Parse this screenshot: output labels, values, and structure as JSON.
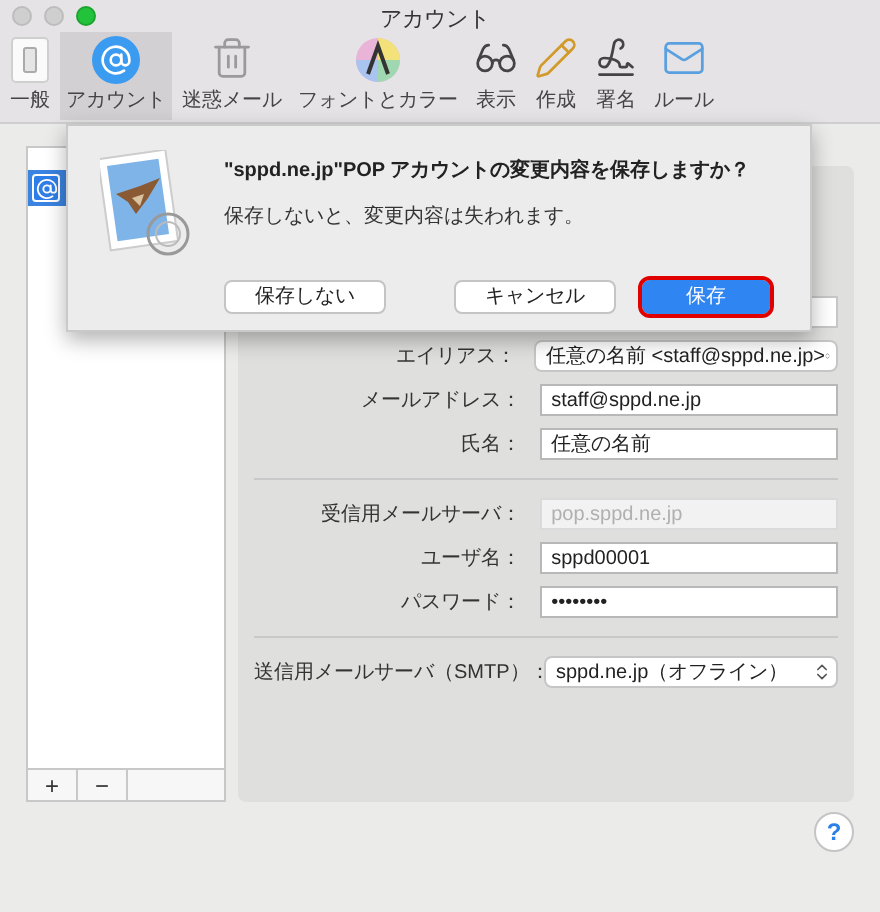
{
  "window": {
    "title": "アカウント"
  },
  "toolbar": {
    "items": [
      {
        "label": "一般",
        "selected": false
      },
      {
        "label": "アカウント",
        "selected": true
      },
      {
        "label": "迷惑メール",
        "selected": false
      },
      {
        "label": "フォントとカラー",
        "selected": false
      },
      {
        "label": "表示",
        "selected": false
      },
      {
        "label": "作成",
        "selected": false
      },
      {
        "label": "署名",
        "selected": false
      },
      {
        "label": "ルール",
        "selected": false
      }
    ]
  },
  "accounts": {
    "items": [
      {
        "selected": true
      }
    ],
    "buttons": [
      "+",
      "−"
    ]
  },
  "form": {
    "sections": [
      {
        "rows": [
          {
            "kind": "select",
            "label": "エイリアス：",
            "value": "任意の名前 <staff@sppd.ne.jp>"
          },
          {
            "kind": "field",
            "label": "メールアドレス：",
            "value": "staff@sppd.ne.jp",
            "disabled": false
          },
          {
            "kind": "field",
            "label": "氏名：",
            "value": "任意の名前",
            "disabled": false
          }
        ]
      },
      {
        "rows": [
          {
            "kind": "field",
            "label": "受信用メールサーバ：",
            "value": "pop.sppd.ne.jp",
            "disabled": true
          },
          {
            "kind": "field",
            "label": "ユーザ名：",
            "value": "sppd00001",
            "disabled": false
          },
          {
            "kind": "field",
            "label": "パスワード：",
            "value": "••••••••",
            "disabled": false
          }
        ]
      },
      {
        "rows": [
          {
            "kind": "select",
            "label": "送信用メールサーバ（SMTP）：",
            "value": "sppd.ne.jp（オフライン）"
          }
        ]
      }
    ]
  },
  "dialog": {
    "title": "\"sppd.ne.jp\"POP アカウントの変更内容を保存しますか？",
    "message": "保存しないと、変更内容は失われます。",
    "buttons": [
      {
        "label": "保存しない",
        "default": false,
        "highlighted": false
      },
      {
        "label": "キャンセル",
        "default": false,
        "highlighted": false
      },
      {
        "label": "保存",
        "default": true,
        "highlighted": true
      }
    ]
  },
  "help": {
    "label": "?"
  }
}
